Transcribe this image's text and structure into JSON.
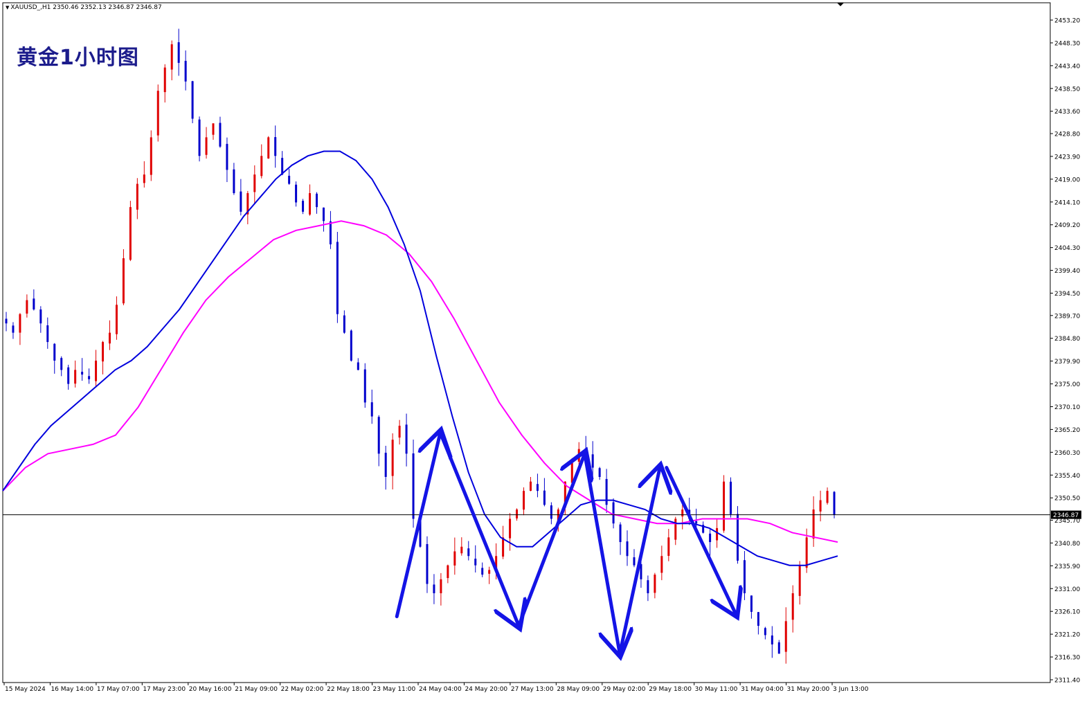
{
  "header": {
    "symbol_line": "XAUUSD_,H1  2350.46 2352.13 2346.87 2346.87"
  },
  "main_title": "黄金1小时图",
  "colors": {
    "bull_candle": "#e00000",
    "bear_candle": "#0000cc",
    "ma_fast": "#0000dd",
    "ma_slow": "#ff00ff",
    "arrows": "#1414e6",
    "title": "#1c1c8c"
  },
  "chart_data": {
    "type": "line",
    "symbol": "XAUUSD_",
    "timeframe": "H1",
    "ylim": [
      2311.4,
      2455.0
    ],
    "y_ticks": [
      "2453.20",
      "2448.30",
      "2443.40",
      "2438.50",
      "2433.60",
      "2428.80",
      "2423.90",
      "2419.00",
      "2414.10",
      "2409.20",
      "2404.30",
      "2399.40",
      "2394.50",
      "2389.70",
      "2384.80",
      "2379.90",
      "2375.00",
      "2370.10",
      "2365.20",
      "2360.30",
      "2355.40",
      "2350.50",
      "2345.70",
      "2340.80",
      "2335.90",
      "2331.00",
      "2326.10",
      "2321.20",
      "2316.30",
      "2311.40"
    ],
    "x_ticks": [
      "15 May 2024",
      "16 May 14:00",
      "17 May 07:00",
      "17 May 23:00",
      "20 May 16:00",
      "21 May 09:00",
      "22 May 02:00",
      "22 May 18:00",
      "23 May 11:00",
      "24 May 04:00",
      "24 May 20:00",
      "27 May 13:00",
      "28 May 09:00",
      "29 May 02:00",
      "29 May 18:00",
      "30 May 11:00",
      "31 May 04:00",
      "31 May 20:00",
      "3 Jun 13:00"
    ],
    "current_price": "2346.87",
    "price_series_close": [
      2388,
      2386,
      2390,
      2393,
      2391,
      2388,
      2384,
      2380,
      2378,
      2375,
      2378,
      2377,
      2376,
      2380,
      2384,
      2386,
      2392,
      2402,
      2413,
      2418,
      2420,
      2428,
      2438,
      2443,
      2448,
      2444,
      2440,
      2432,
      2424,
      2428,
      2431,
      2426,
      2421,
      2416,
      2412,
      2416,
      2420,
      2424,
      2428,
      2424,
      2420,
      2418,
      2414,
      2412,
      2416,
      2413,
      2410,
      2405,
      2390,
      2386,
      2380,
      2378,
      2371,
      2368,
      2360,
      2355,
      2363,
      2366,
      2360,
      2346,
      2340,
      2332,
      2330,
      2333,
      2336,
      2339,
      2340,
      2338,
      2336,
      2334,
      2335,
      2338,
      2342,
      2346,
      2348,
      2352,
      2354,
      2352,
      2349,
      2346,
      2348,
      2354,
      2358,
      2361,
      2360,
      2357,
      2355,
      2349,
      2345,
      2341,
      2338,
      2336,
      2333,
      2330,
      2334,
      2338,
      2342,
      2346,
      2348,
      2346,
      2345,
      2343,
      2341,
      2344,
      2354,
      2347,
      2337,
      2330,
      2326,
      2323,
      2321,
      2319,
      2317,
      2324,
      2330,
      2336,
      2342,
      2348,
      2350,
      2352,
      2346.87
    ],
    "ma_fast_series": [
      2352,
      2357,
      2362,
      2366,
      2369,
      2372,
      2375,
      2378,
      2380,
      2383,
      2387,
      2391,
      2396,
      2401,
      2406,
      2411,
      2415,
      2419,
      2422,
      2424,
      2425,
      2425,
      2423,
      2419,
      2413,
      2405,
      2395,
      2381,
      2368,
      2356,
      2347,
      2342,
      2340,
      2340,
      2343,
      2346,
      2349,
      2350,
      2350,
      2349,
      2348,
      2346,
      2345,
      2345,
      2344,
      2342,
      2340,
      2338,
      2337,
      2336,
      2336,
      2337,
      2338
    ],
    "ma_slow_series": [
      2352,
      2357,
      2360,
      2361,
      2362,
      2364,
      2370,
      2378,
      2386,
      2393,
      2398,
      2402,
      2406,
      2408,
      2409,
      2410,
      2409,
      2407,
      2403,
      2397,
      2389,
      2380,
      2371,
      2364,
      2358,
      2353,
      2350,
      2347,
      2346,
      2345,
      2345,
      2346,
      2346,
      2346,
      2345,
      2343,
      2342,
      2341
    ],
    "annotations": [
      {
        "type": "arrow",
        "from": [
          0.472,
          2325.0
        ],
        "to": [
          0.524,
          2364.5
        ]
      },
      {
        "type": "arrow",
        "from": [
          0.524,
          2364.5
        ],
        "to": [
          0.618,
          2323.0
        ]
      },
      {
        "type": "arrow",
        "from": [
          0.618,
          2323.0
        ],
        "to": [
          0.697,
          2360.0
        ]
      },
      {
        "type": "arrow",
        "from": [
          0.697,
          2360.0
        ],
        "to": [
          0.739,
          2317.0
        ]
      },
      {
        "type": "arrow",
        "from": [
          0.739,
          2317.0
        ],
        "to": [
          0.787,
          2357.0
        ]
      },
      {
        "type": "arrow",
        "from": [
          0.795,
          2357.0
        ],
        "to": [
          0.878,
          2325.5
        ]
      }
    ]
  }
}
